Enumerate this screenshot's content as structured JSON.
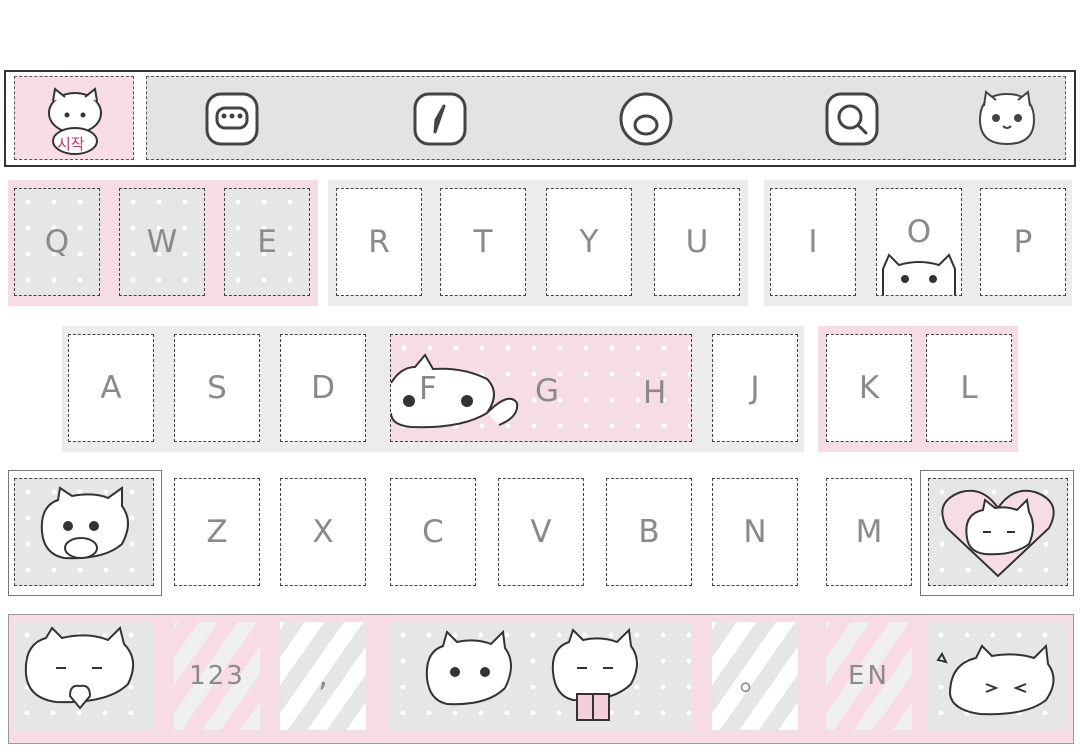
{
  "toolbar": {
    "logo_text": "시작",
    "buttons": [
      {
        "icon": "emoji-keyboard-icon"
      },
      {
        "icon": "compass-icon"
      },
      {
        "icon": "sticker-icon"
      },
      {
        "icon": "search-icon"
      },
      {
        "icon": "cat-face-icon"
      }
    ]
  },
  "rows": {
    "row1": [
      "Q",
      "W",
      "E",
      "R",
      "T",
      "Y",
      "U",
      "I",
      "O",
      "P"
    ],
    "row2": [
      "A",
      "S",
      "D",
      "F",
      "G",
      "H",
      "J",
      "K",
      "L"
    ],
    "row3": [
      "Z",
      "X",
      "C",
      "V",
      "B",
      "N",
      "M"
    ]
  },
  "bottom": {
    "numbers_label": "123",
    "comma_label": ",",
    "period_label": "。",
    "lang_label": "EN"
  },
  "colors": {
    "pink": "#f6dde5",
    "grey": "#e6e6e6",
    "key_text": "#8a8a8a",
    "border": "#444444"
  }
}
